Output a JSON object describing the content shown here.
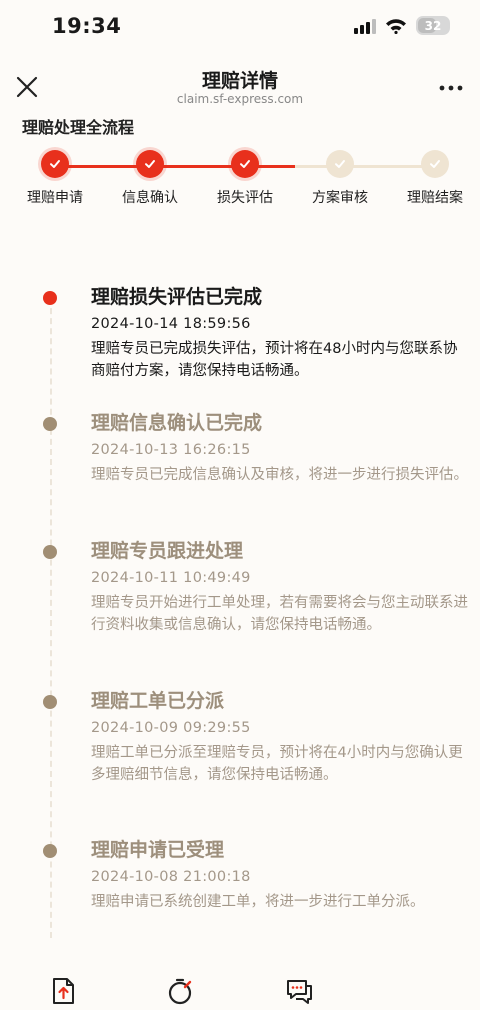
{
  "status_bar": {
    "time": "19:34",
    "battery": "32"
  },
  "nav": {
    "title": "理赔详情",
    "subtitle": "claim.sf-express.com"
  },
  "section_title": "理赔处理全流程",
  "steps": [
    {
      "label": "理赔申请",
      "status": "done"
    },
    {
      "label": "信息确认",
      "status": "done"
    },
    {
      "label": "损失评估",
      "status": "done"
    },
    {
      "label": "方案审核",
      "status": "pending"
    },
    {
      "label": "理赔结案",
      "status": "pending"
    }
  ],
  "timeline": [
    {
      "title": "理赔损失评估已完成",
      "time": "2024-10-14 18:59:56",
      "desc": "理赔专员已完成损失评估，预计将在48小时内与您联系协商赔付方案，请您保持电话畅通。",
      "active": true
    },
    {
      "title": "理赔信息确认已完成",
      "time": "2024-10-13 16:26:15",
      "desc": "理赔专员已完成信息确认及审核，将进一步进行损失评估。",
      "active": false
    },
    {
      "title": "理赔专员跟进处理",
      "time": "2024-10-11 10:49:49",
      "desc": "理赔专员开始进行工单处理，若有需要将会与您主动联系进行资料收集或信息确认，请您保持电话畅通。",
      "active": false
    },
    {
      "title": "理赔工单已分派",
      "time": "2024-10-09 09:29:55",
      "desc": "理赔工单已分派至理赔专员，预计将在4小时内与您确认更多理赔细节信息，请您保持电话畅通。",
      "active": false
    },
    {
      "title": "理赔申请已受理",
      "time": "2024-10-08 21:00:18",
      "desc": "理赔申请已系统创建工单，将进一步进行工单分派。",
      "active": false
    }
  ],
  "colors": {
    "accent_red": "#e8301c",
    "pending": "#efe4d2",
    "pending_check": "#ffffff",
    "muted_title": "#9d8f7c",
    "muted_text": "#a4988a",
    "muted_dot": "#a18e74",
    "active_text": "#1a1a1a"
  },
  "icons": {
    "close": "close-icon",
    "more": "more-icon",
    "upload": "upload-document-icon",
    "timer": "timer-icon",
    "chat": "chat-icon"
  }
}
